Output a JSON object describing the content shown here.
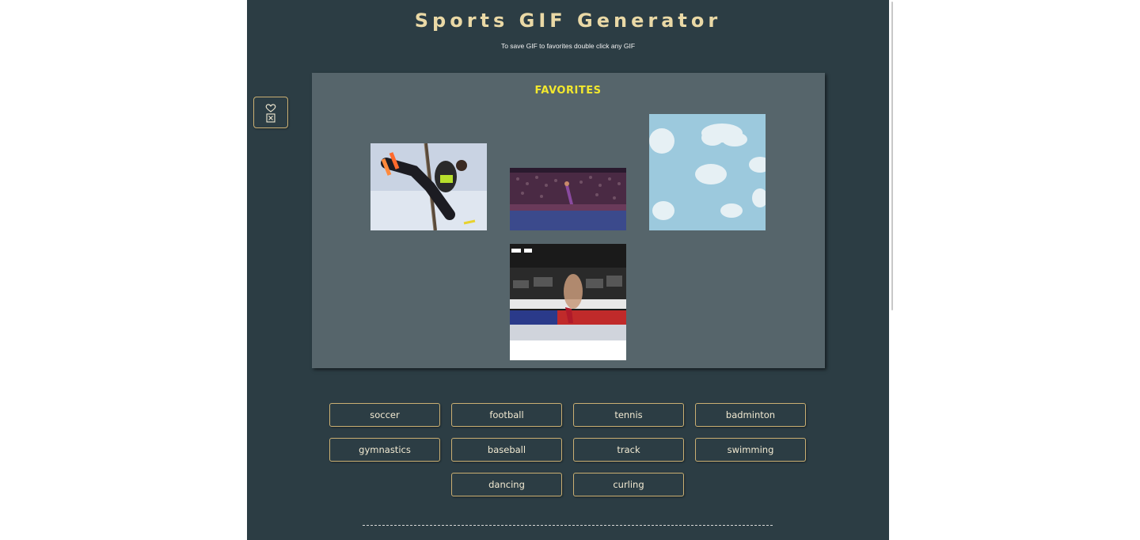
{
  "header": {
    "title": "Sports GIF Generator",
    "subtitle": "To save GIF to favorites double click any GIF"
  },
  "favorites_toggle": {
    "icons": [
      "heart-icon",
      "close-box-icon"
    ]
  },
  "favorites": {
    "heading": "FAVORITES",
    "gifs": [
      {
        "subject": "rope climb athlete"
      },
      {
        "subject": "gymnastics arena"
      },
      {
        "subject": "sky with clouds"
      },
      {
        "subject": "gymnast flip"
      }
    ]
  },
  "sports": [
    "soccer",
    "football",
    "tennis",
    "badminton",
    "gymnastics",
    "baseball",
    "track",
    "swimming",
    "dancing",
    "curling"
  ],
  "colors": {
    "background": "#2c3d44",
    "panel": "#56656b",
    "title": "#ead9a6",
    "favorites_heading": "#f2e82e",
    "button_border": "#cbb073"
  }
}
